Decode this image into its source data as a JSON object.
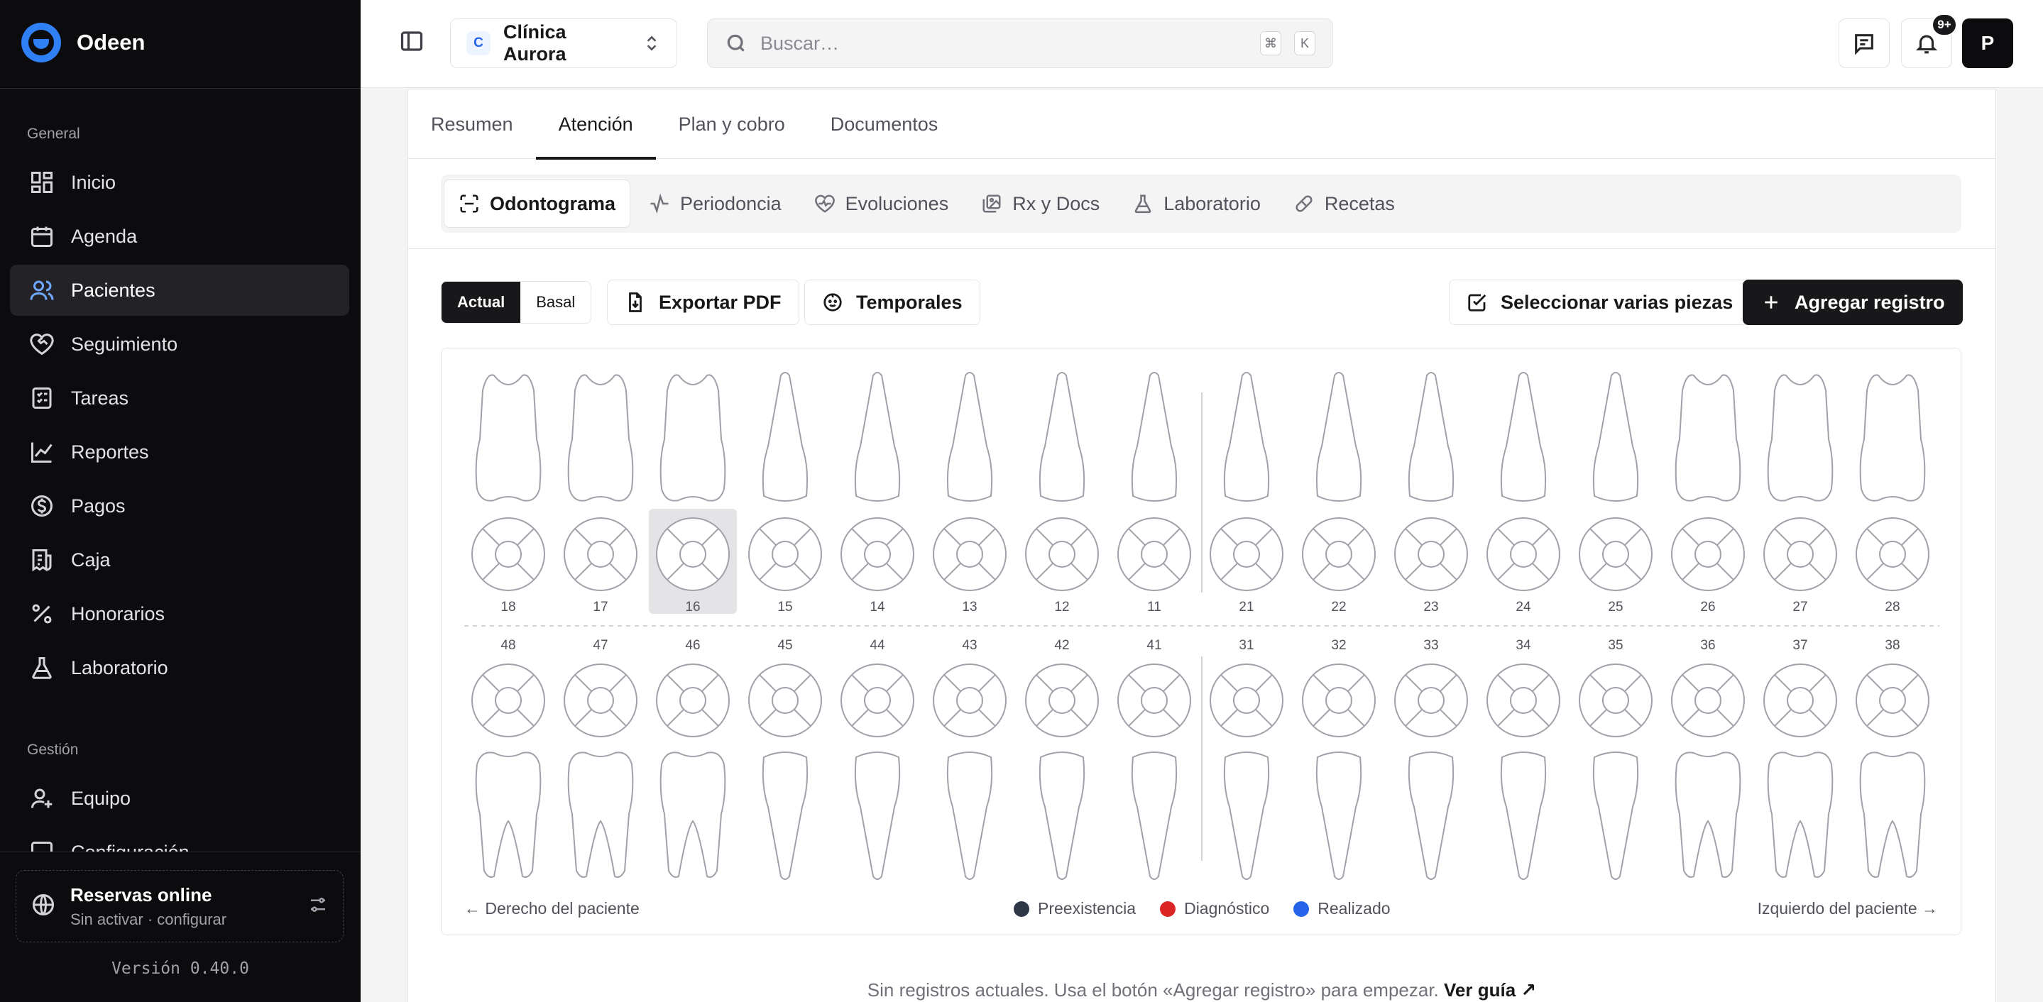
{
  "brand": {
    "name": "Odeen"
  },
  "sidebar": {
    "sections": [
      {
        "title": "General"
      },
      {
        "title": "Gestión"
      }
    ],
    "items": [
      {
        "label": "Inicio",
        "icon": "dashboard-icon"
      },
      {
        "label": "Agenda",
        "icon": "calendar-icon"
      },
      {
        "label": "Pacientes",
        "icon": "users-icon",
        "active": true
      },
      {
        "label": "Seguimiento",
        "icon": "heart-handshake-icon"
      },
      {
        "label": "Tareas",
        "icon": "checklist-icon"
      },
      {
        "label": "Reportes",
        "icon": "line-chart-icon"
      },
      {
        "label": "Pagos",
        "icon": "dollar-circle-icon"
      },
      {
        "label": "Caja",
        "icon": "receipt-icon"
      },
      {
        "label": "Honorarios",
        "icon": "percent-icon"
      },
      {
        "label": "Laboratorio",
        "icon": "flask-icon"
      },
      {
        "label": "Equipo",
        "icon": "user-plus-icon"
      },
      {
        "label": "Configuración",
        "icon": "settings-icon"
      }
    ],
    "booking": {
      "title": "Reservas online",
      "subtitle": "Sin activar · configurar"
    },
    "version": "Versión 0.40.0"
  },
  "topbar": {
    "clinic": {
      "badge": "C",
      "name": "Clínica Aurora"
    },
    "search": {
      "placeholder": "Buscar…",
      "kbd1": "⌘",
      "kbd2": "K"
    },
    "notifications_badge": "9+",
    "avatar": "P"
  },
  "tabs": [
    {
      "label": "Resumen"
    },
    {
      "label": "Atención",
      "active": true
    },
    {
      "label": "Plan y cobro"
    },
    {
      "label": "Documentos"
    }
  ],
  "subtabs": [
    {
      "label": "Odontograma",
      "icon": "scan-icon",
      "active": true
    },
    {
      "label": "Periodoncia",
      "icon": "activity-icon"
    },
    {
      "label": "Evoluciones",
      "icon": "heart-pulse-icon"
    },
    {
      "label": "Rx y Docs",
      "icon": "images-icon"
    },
    {
      "label": "Laboratorio",
      "icon": "flask-icon"
    },
    {
      "label": "Recetas",
      "icon": "pill-icon"
    }
  ],
  "toolbar": {
    "view_actual": "Actual",
    "view_basal": "Basal",
    "export": "Exportar PDF",
    "temporales": "Temporales",
    "select_multiple": "Seleccionar varias piezas",
    "add_record": "Agregar registro"
  },
  "odontogram": {
    "upper_teeth": [
      "18",
      "17",
      "16",
      "15",
      "14",
      "13",
      "12",
      "11",
      "21",
      "22",
      "23",
      "24",
      "25",
      "26",
      "27",
      "28"
    ],
    "lower_teeth": [
      "48",
      "47",
      "46",
      "45",
      "44",
      "43",
      "42",
      "41",
      "31",
      "32",
      "33",
      "34",
      "35",
      "36",
      "37",
      "38"
    ],
    "selected_tooth": "16",
    "left_caption": "← Derecho del paciente",
    "right_caption": "Izquierdo del paciente →",
    "legend": [
      {
        "label": "Preexistencia",
        "color": "#2d3748"
      },
      {
        "label": "Diagnóstico",
        "color": "#dc2626"
      },
      {
        "label": "Realizado",
        "color": "#2563eb"
      }
    ]
  },
  "empty_hint": {
    "text": "Sin registros actuales. Usa el botón «Agregar registro» para empezar.",
    "link": "Ver guía"
  }
}
